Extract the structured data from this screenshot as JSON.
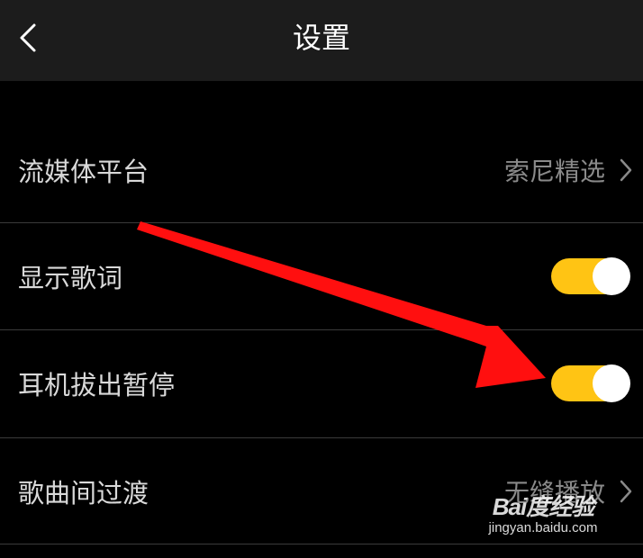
{
  "header": {
    "title": "设置"
  },
  "settings": {
    "streaming": {
      "label": "流媒体平台",
      "value": "索尼精选"
    },
    "lyrics": {
      "label": "显示歌词",
      "toggle_on": true
    },
    "headphone_pause": {
      "label": "耳机拔出暂停",
      "toggle_on": true
    },
    "crossfade": {
      "label": "歌曲间过渡",
      "value": "无缝播放"
    }
  },
  "colors": {
    "background": "#000000",
    "header": "#1c1c1c",
    "toggle_on": "#ffc414",
    "annotation_arrow": "#ff0f0f"
  },
  "watermark": {
    "logo": "Bai度经验",
    "url": "jingyan.baidu.com"
  }
}
